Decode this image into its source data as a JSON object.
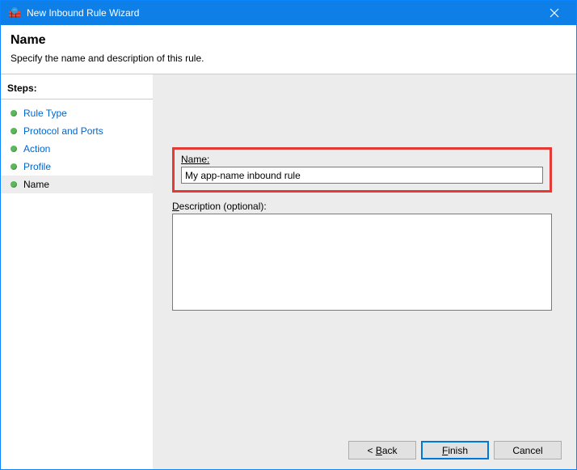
{
  "window": {
    "title": "New Inbound Rule Wizard"
  },
  "header": {
    "title": "Name",
    "subtitle": "Specify the name and description of this rule."
  },
  "sidebar": {
    "steps_label": "Steps:",
    "items": [
      {
        "label": "Rule Type"
      },
      {
        "label": "Protocol and Ports"
      },
      {
        "label": "Action"
      },
      {
        "label": "Profile"
      },
      {
        "label": "Name"
      }
    ]
  },
  "form": {
    "name_label": "Name:",
    "name_value": "My app-name inbound rule",
    "description_label": "Description (optional):",
    "description_value": ""
  },
  "buttons": {
    "back": "< Back",
    "finish": "Finish",
    "cancel": "Cancel"
  }
}
